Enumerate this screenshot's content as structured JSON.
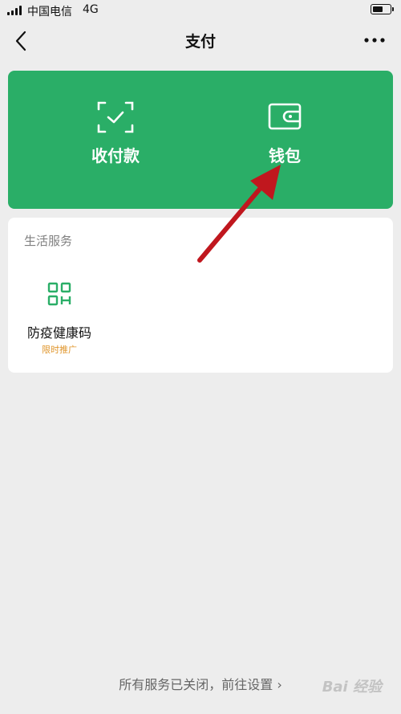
{
  "status_bar": {
    "carrier": "中国电信",
    "network": "4G"
  },
  "nav": {
    "title": "支付",
    "back_icon": "chevron-left-icon",
    "more_icon": "more-dots-icon"
  },
  "pay_card": {
    "background": "#2aae67",
    "collect": {
      "label": "收付款",
      "icon": "scan-check-icon"
    },
    "wallet": {
      "label": "钱包",
      "icon": "wallet-icon"
    }
  },
  "services": {
    "title": "生活服务",
    "items": [
      {
        "name": "防疫健康码",
        "promo": "限时推广",
        "icon": "qr-code-icon"
      }
    ]
  },
  "footer": {
    "link_text": "所有服务已关闭，前往设置 ›"
  },
  "watermark": {
    "text": "Bai 经验"
  },
  "annotation": {
    "color": "#c0171e"
  }
}
